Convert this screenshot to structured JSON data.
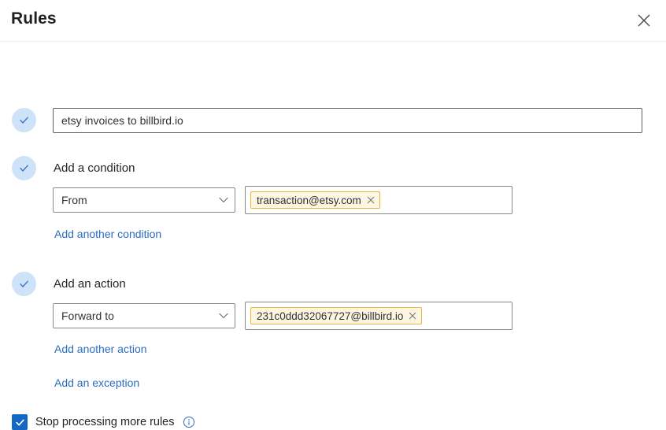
{
  "header": {
    "title": "Rules",
    "close_icon": "close-icon"
  },
  "rule": {
    "name_value": "etsy invoices to billbird.io",
    "name_placeholder": "",
    "condition": {
      "label": "Add a condition",
      "field_value": "From",
      "caret_icon": "chevron-down-icon",
      "tokens": [
        {
          "text": "transaction@etsy.com",
          "remove_icon": "close-icon"
        }
      ],
      "add_link": "Add another condition",
      "check_icon": "checkmark-icon"
    },
    "action": {
      "label": "Add an action",
      "field_value": "Forward to",
      "caret_icon": "chevron-down-icon",
      "tokens": [
        {
          "text": "231c0ddd32067727@billbird.io",
          "remove_icon": "close-icon"
        }
      ],
      "add_link": "Add another action",
      "check_icon": "checkmark-icon"
    },
    "exception": {
      "add_link": "Add an exception"
    },
    "name_check_icon": "checkmark-icon",
    "stop_processing": {
      "label": "Stop processing more rules",
      "checked": true,
      "info_icon": "info-icon"
    }
  },
  "colors": {
    "accent": "#1268c3",
    "link": "#2a6dc0",
    "check_circle_bg": "#cfe3f8",
    "token_bg": "#fdf6e3",
    "token_border": "#e9b63c"
  }
}
